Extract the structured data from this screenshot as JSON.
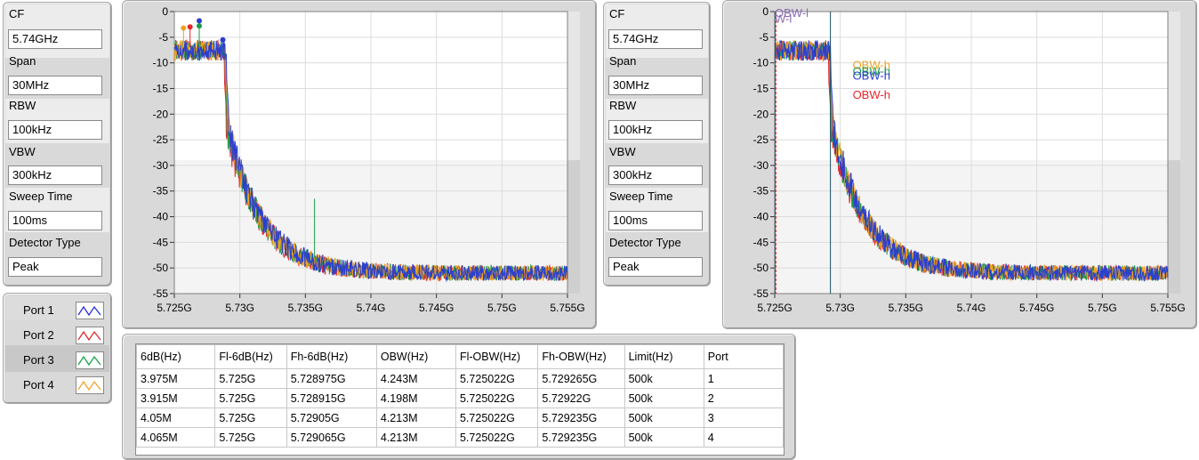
{
  "settings_left": {
    "cf_label": "CF",
    "cf_value": "5.74GHz",
    "span_label": "Span",
    "span_value": "30MHz",
    "rbw_label": "RBW",
    "rbw_value": "100kHz",
    "vbw_label": "VBW",
    "vbw_value": "300kHz",
    "sweep_label": "Sweep Time",
    "sweep_value": "100ms",
    "detector_label": "Detector Type",
    "detector_value": "Peak"
  },
  "settings_right": {
    "cf_label": "CF",
    "cf_value": "5.74GHz",
    "span_label": "Span",
    "span_value": "30MHz",
    "rbw_label": "RBW",
    "rbw_value": "100kHz",
    "vbw_label": "VBW",
    "vbw_value": "300kHz",
    "sweep_label": "Sweep Time",
    "sweep_value": "100ms",
    "detector_label": "Detector Type",
    "detector_value": "Peak"
  },
  "legend": [
    {
      "name": "Port 1",
      "color": "#2020e0"
    },
    {
      "name": "Port 2",
      "color": "#e02020"
    },
    {
      "name": "Port 3",
      "color": "#10a040"
    },
    {
      "name": "Port 4",
      "color": "#f0a020"
    }
  ],
  "colors": {
    "port1": "#2b3fcf",
    "port2": "#e8262a",
    "port3": "#1a9a4a",
    "port4": "#f0a020",
    "marker_line": "#1a5060"
  },
  "chart_data": [
    {
      "type": "line",
      "title": "",
      "xlabel": "",
      "ylabel": "",
      "xlim": [
        5.725,
        5.755
      ],
      "ylim": [
        -55,
        0
      ],
      "x_tick_labels": [
        "5.725G",
        "5.73G",
        "5.735G",
        "5.74G",
        "5.745G",
        "5.75G",
        "5.755G"
      ],
      "y_tick_labels": [
        "0",
        "-5",
        "-10",
        "-15",
        "-20",
        "-25",
        "-30",
        "-35",
        "-40",
        "-45",
        "-50",
        "-55"
      ],
      "series_shape": {
        "in_band_level_dbm": -7,
        "band_edge_ghz": 5.7289,
        "noise_floor_dbm": -51
      },
      "series": [
        {
          "color": "#e8262a"
        },
        {
          "color": "#1a9a4a"
        },
        {
          "color": "#f0a020"
        },
        {
          "color": "#2b3fcf"
        }
      ],
      "peak_markers": [
        {
          "x": 5.7257,
          "y": -3.2,
          "color": "#f0a020"
        },
        {
          "x": 5.7262,
          "y": -3.0,
          "color": "#e8262a"
        },
        {
          "x": 5.7269,
          "y": -1.8,
          "color": "#2b3fcf"
        },
        {
          "x": 5.7269,
          "y": -2.8,
          "color": "#1a9a4a"
        },
        {
          "x": 5.7287,
          "y": -5.5,
          "color": "#2b3fcf"
        }
      ],
      "spur": {
        "x": 5.7357,
        "y_top": -36.5,
        "color": "#1a9a4a"
      }
    },
    {
      "type": "line",
      "title": "",
      "xlabel": "",
      "ylabel": "",
      "xlim": [
        5.725,
        5.755
      ],
      "ylim": [
        -55,
        0
      ],
      "x_tick_labels": [
        "5.725G",
        "5.73G",
        "5.735G",
        "5.74G",
        "5.745G",
        "5.75G",
        "5.755G"
      ],
      "y_tick_labels": [
        "0",
        "-5",
        "-10",
        "-15",
        "-20",
        "-25",
        "-30",
        "-35",
        "-40",
        "-45",
        "-50",
        "-55"
      ],
      "series_shape": {
        "in_band_level_dbm": -7,
        "band_edge_ghz": 5.7292,
        "noise_floor_dbm": -51
      },
      "series": [
        {
          "color": "#e8262a"
        },
        {
          "color": "#1a9a4a"
        },
        {
          "color": "#f0a020"
        },
        {
          "color": "#2b3fcf"
        }
      ],
      "cursor_lines": [
        5.725022,
        5.72925
      ],
      "annotations": [
        {
          "text": "OBW-l",
          "x": 5.725,
          "y": -1.0,
          "color": "#8a6ab0"
        },
        {
          "text": "W-l",
          "x": 5.725,
          "y": -2.2,
          "color": "#8a6ab0"
        },
        {
          "text": "OBW-h",
          "x": 5.7285,
          "y": -11.2,
          "color": "#f0a020"
        },
        {
          "text": "OBW-h",
          "x": 5.7285,
          "y": -12.4,
          "color": "#1a9a4a"
        },
        {
          "text": "OBW-h",
          "x": 5.7285,
          "y": -13.3,
          "color": "#2b3fcf"
        },
        {
          "text": "OBW-h",
          "x": 5.7285,
          "y": -17.0,
          "color": "#e8262a"
        }
      ]
    }
  ],
  "table": {
    "headers": [
      "6dB(Hz)",
      "Fl-6dB(Hz)",
      "Fh-6dB(Hz)",
      "OBW(Hz)",
      "Fl-OBW(Hz)",
      "Fh-OBW(Hz)",
      "Limit(Hz)",
      "Port"
    ],
    "rows": [
      [
        "3.975M",
        "5.725G",
        "5.728975G",
        "4.243M",
        "5.725022G",
        "5.729265G",
        "500k",
        "1"
      ],
      [
        "3.915M",
        "5.725G",
        "5.728915G",
        "4.198M",
        "5.725022G",
        "5.72922G",
        "500k",
        "2"
      ],
      [
        "4.05M",
        "5.725G",
        "5.72905G",
        "4.213M",
        "5.725022G",
        "5.729235G",
        "500k",
        "3"
      ],
      [
        "4.065M",
        "5.725G",
        "5.729065G",
        "4.213M",
        "5.725022G",
        "5.729235G",
        "500k",
        "4"
      ]
    ]
  }
}
